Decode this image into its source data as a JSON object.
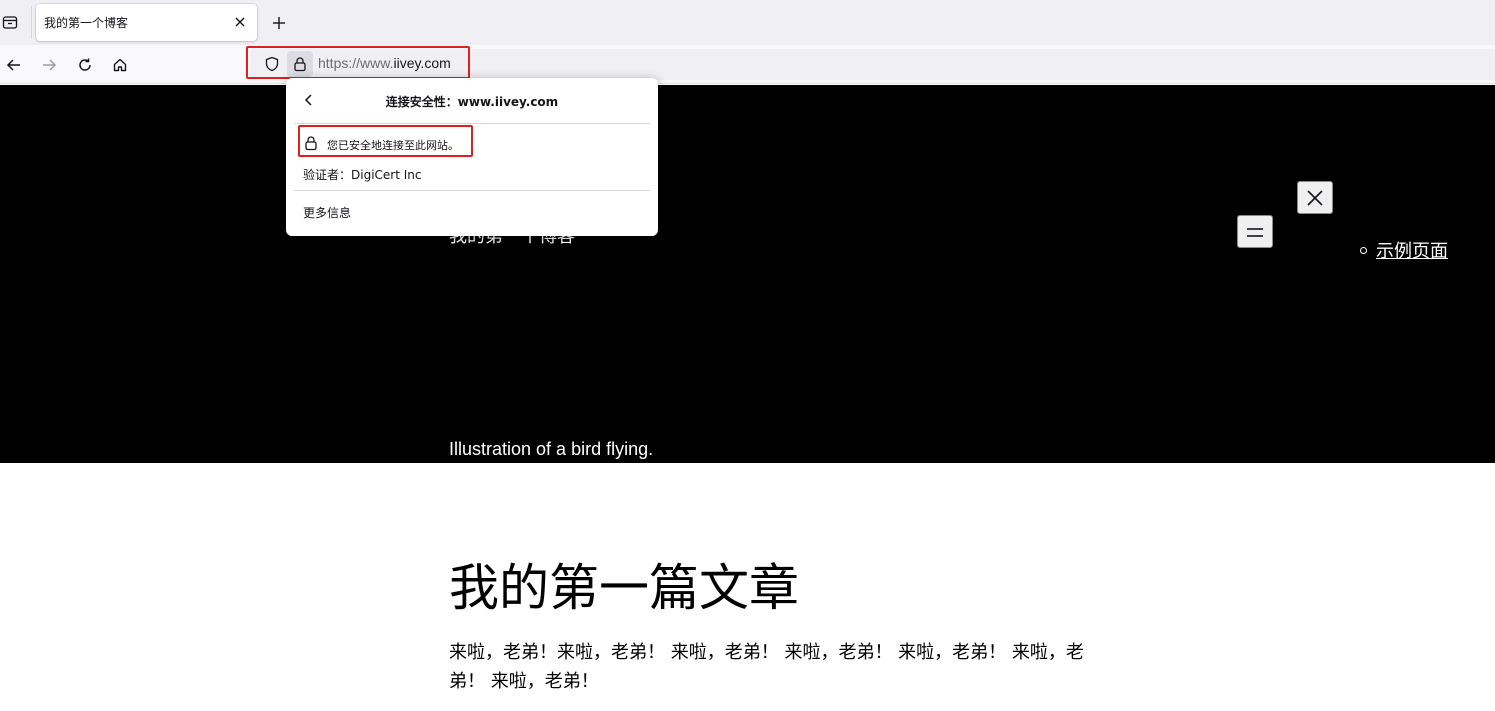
{
  "tab": {
    "title": "我的第一个博客"
  },
  "navbar": {
    "url_scheme": "https://www.",
    "url_domain": "iivey.com"
  },
  "security_popup": {
    "header": "连接安全性：www.iivey.com",
    "secure_text": "您已安全地连接至此网站。",
    "verifier_label": "验证者：",
    "verifier_value": "DigiCert Inc",
    "more_info": "更多信息",
    "highlight_color": "#e02020"
  },
  "page": {
    "site_title": "我的第一个博客",
    "nav_link": "示例页面",
    "hero_caption": "Illustration of a bird flying.",
    "post_title": "我的第一篇文章",
    "post_body": "来啦，老弟！来啦，老弟！ 来啦，老弟！ 来啦，老弟！ 来啦，老弟！ 来啦，老弟！ 来啦，老弟！",
    "hero_background": "#000000"
  },
  "icons": {
    "tab_list": "tab-list-icon",
    "close_tab": "close-icon",
    "new_tab": "plus-icon",
    "back": "arrow-left-icon",
    "forward": "arrow-right-icon",
    "reload": "reload-icon",
    "home": "home-icon",
    "tracking_protection": "shield-icon",
    "site_lock": "lock-icon",
    "close_menu": "close-icon",
    "open_menu": "menu-icon"
  }
}
